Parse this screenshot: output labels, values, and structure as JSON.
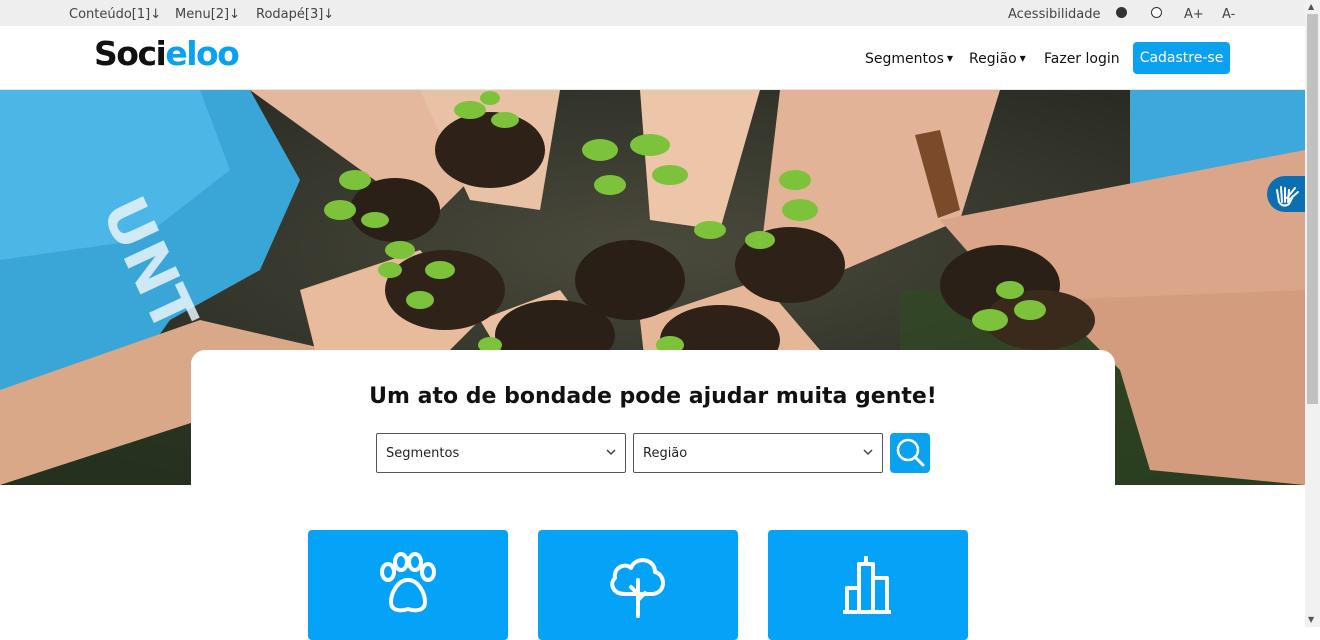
{
  "accessibility_bar": {
    "skip_links": [
      "Conteúdo[1]↓",
      "Menu[2]↓",
      "Rodapé[3]↓"
    ],
    "accessibility_label": "Acessibilidade",
    "font_increase": "A+",
    "font_decrease": "A-"
  },
  "header": {
    "logo_part1": "Soci",
    "logo_part2": "eloo",
    "nav": {
      "segments": "Segmentos",
      "region": "Região",
      "login": "Fazer login",
      "signup": "Cadastre-se"
    }
  },
  "search": {
    "headline": "Um ato de bondade pode ajudar muita gente!",
    "segment_select": "Segmentos",
    "region_select": "Região"
  },
  "categories": [
    {
      "icon": "paw-icon"
    },
    {
      "icon": "tree-icon"
    },
    {
      "icon": "buildings-icon"
    }
  ],
  "colors": {
    "accent": "#0aa2f0",
    "category_bg": "#04a3f7",
    "libras_widget": "#0b6fb2"
  }
}
